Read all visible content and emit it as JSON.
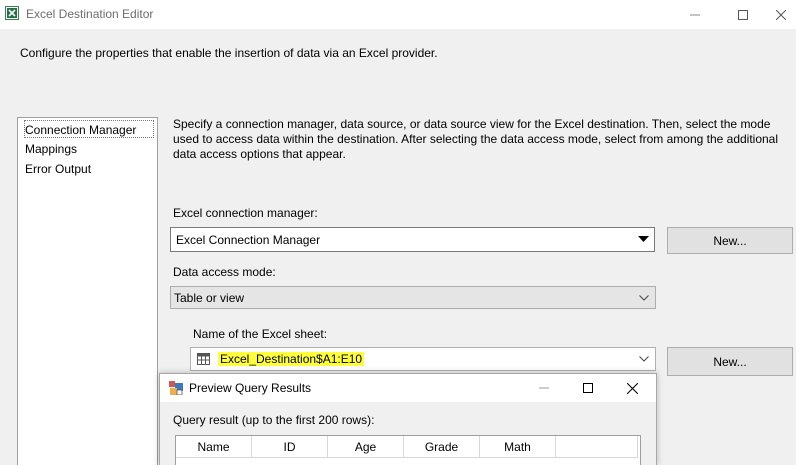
{
  "window": {
    "title": "Excel Destination Editor",
    "header_description": "Configure the properties that enable the insertion of data via an Excel provider."
  },
  "nav": {
    "items": [
      {
        "label": "Connection Manager",
        "selected": true
      },
      {
        "label": "Mappings",
        "selected": false
      },
      {
        "label": "Error Output",
        "selected": false
      }
    ]
  },
  "main": {
    "description": "Specify a connection manager, data source, or data source view for the Excel destination. Then, select the mode used to access data within the destination. After selecting the data access mode, select from among the additional data access options that appear.",
    "connection_manager_label": "Excel connection manager:",
    "connection_manager_value": "Excel Connection Manager",
    "new_button_1": "New...",
    "access_mode_label": "Data access mode:",
    "access_mode_value": "Table or view",
    "sheet_label": "Name of the Excel sheet:",
    "sheet_value": "Excel_Destination$A1:E10",
    "new_button_2": "New...",
    "highlight_color": "#ffff3c"
  },
  "preview_dialog": {
    "title": "Preview Query Results",
    "result_label": "Query result (up to the first 200 rows):",
    "columns": [
      "Name",
      "ID",
      "Age",
      "Grade",
      "Math",
      ""
    ]
  }
}
